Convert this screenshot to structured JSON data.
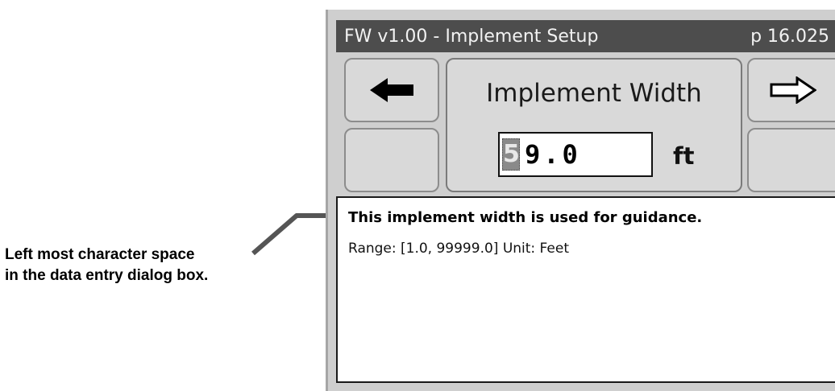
{
  "callout": {
    "line1": "Left most character space",
    "line2": "in the data entry dialog box."
  },
  "titlebar": {
    "left": "FW v1.00 - Implement Setup",
    "right": "p 16.025"
  },
  "nav": {
    "prev_icon": "arrow-left-icon",
    "next_icon": "arrow-right-icon"
  },
  "parameter": {
    "title": "Implement Width",
    "cursor_char": "5",
    "rest_value": "9.0",
    "unit": "ft"
  },
  "info": {
    "description": "This implement width is used for guidance.",
    "range": "Range: [1.0, 99999.0]  Unit: Feet"
  },
  "colors": {
    "titlebar_bg": "#4d4d4d",
    "panel_bg": "#d9d9d9",
    "cursor_bg": "#8a8a8a"
  }
}
